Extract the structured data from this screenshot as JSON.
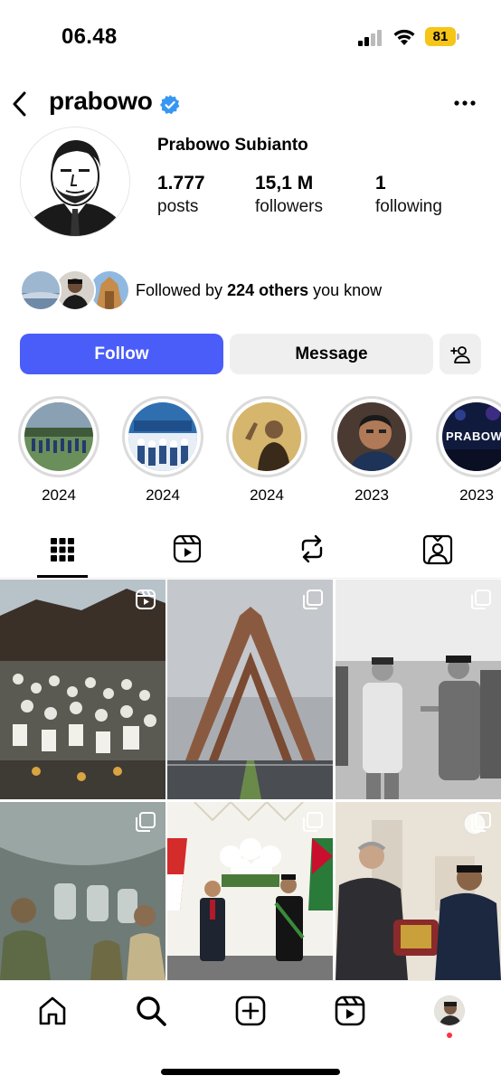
{
  "status_bar": {
    "time": "06.48",
    "battery": "81"
  },
  "header": {
    "username": "prabowo"
  },
  "profile": {
    "full_name": "Prabowo Subianto",
    "stats": [
      {
        "value": "1.777",
        "label": "posts"
      },
      {
        "value": "15,1 M",
        "label": "followers"
      },
      {
        "value": "1",
        "label": "following"
      }
    ]
  },
  "followed_by": {
    "prefix": "Followed by ",
    "bold": "224 others",
    "suffix": " you know"
  },
  "actions": {
    "follow": "Follow",
    "message": "Message"
  },
  "highlights": [
    {
      "label": "2024"
    },
    {
      "label": "2024"
    },
    {
      "label": "2024"
    },
    {
      "label": "2023"
    },
    {
      "label": "2023",
      "overlay_text": "PRABOWO"
    }
  ],
  "tabs": [
    "grid-icon",
    "reels-icon",
    "reposts-icon",
    "tagged-icon"
  ],
  "colors": {
    "follow_button": "#4a5df9",
    "verified": "#3797f0",
    "battery": "#f5c518",
    "notification_dot": "#ff3040"
  },
  "bottom_nav": [
    "home-icon",
    "search-icon",
    "create-icon",
    "reels-icon",
    "profile-avatar"
  ]
}
